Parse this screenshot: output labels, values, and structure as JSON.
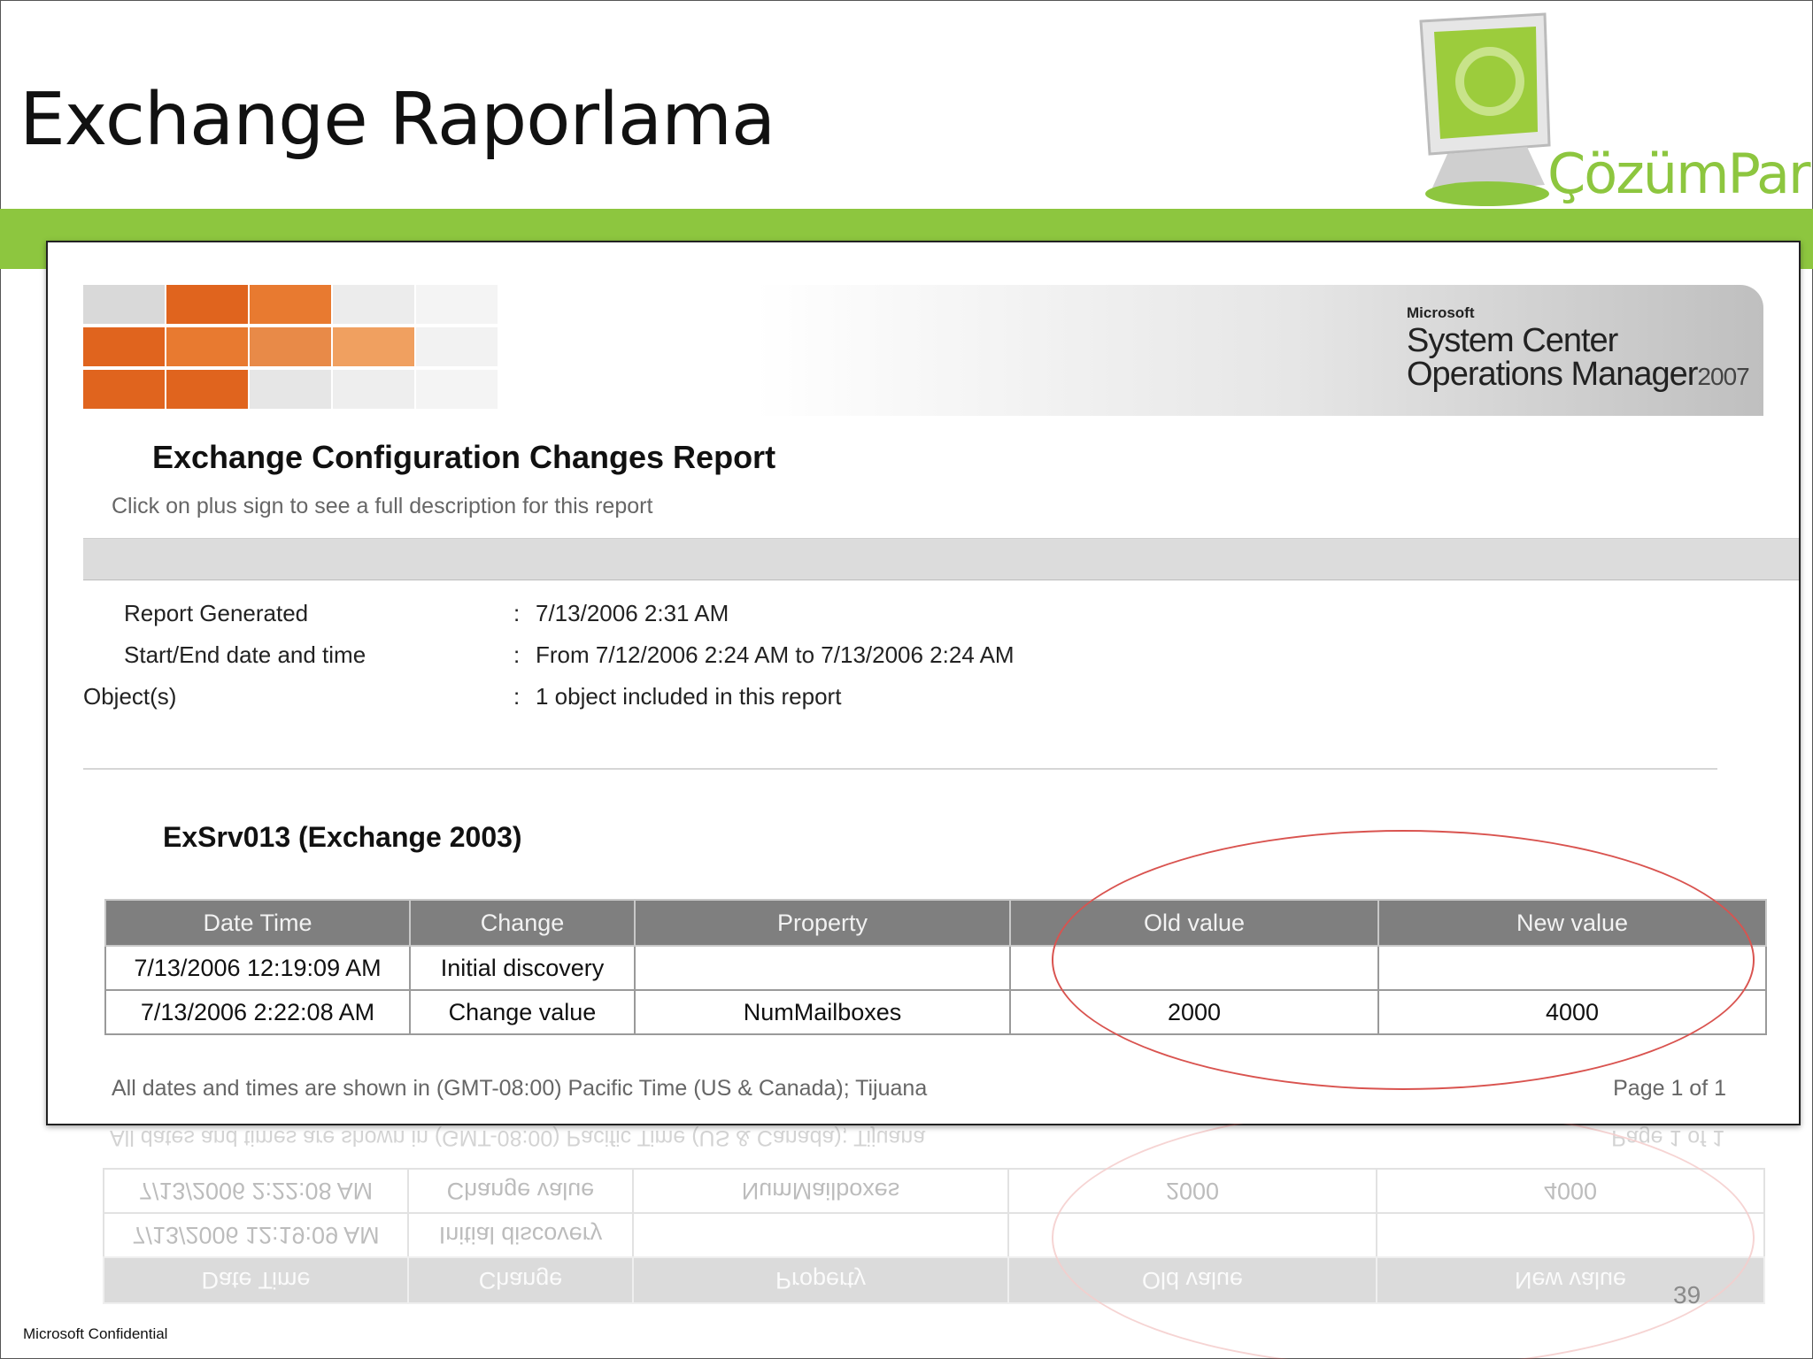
{
  "slide": {
    "title": "Exchange Raporlama",
    "logo_text": "ÇözümPark",
    "page_number": "39",
    "confidential": "Microsoft Confidential"
  },
  "report": {
    "brand_small": "Microsoft",
    "brand_line1": "System Center",
    "brand_line2": "Operations Manager",
    "brand_year": "2007",
    "title": "Exchange Configuration Changes Report",
    "subtitle": "Click on plus sign to see a full description for this report",
    "meta": [
      {
        "label": "Report Generated",
        "value": "7/13/2006 2:31 AM"
      },
      {
        "label": "Start/End date and time",
        "value": "From 7/12/2006 2:24 AM to 7/13/2006 2:24 AM"
      },
      {
        "label": "Object(s)",
        "value": "1 object included in this report"
      }
    ],
    "server": "ExSrv013 (Exchange 2003)",
    "table": {
      "headers": [
        "Date Time",
        "Change",
        "Property",
        "Old value",
        "New value"
      ],
      "rows": [
        [
          "7/13/2006 12:19:09 AM",
          "Initial discovery",
          "",
          "",
          ""
        ],
        [
          "7/13/2006 2:22:08 AM",
          "Change value",
          "NumMailboxes",
          "2000",
          "4000"
        ]
      ]
    },
    "footer_timezone": "All dates and times are shown in (GMT-08:00) Pacific Time (US & Canada); Tijuana",
    "footer_page": "Page 1 of 1"
  },
  "colors": {
    "green_band": "#8dc63f",
    "header_gray": "#7f7f7f",
    "ellipse": "#d9534f",
    "orange": "#e0641e"
  }
}
